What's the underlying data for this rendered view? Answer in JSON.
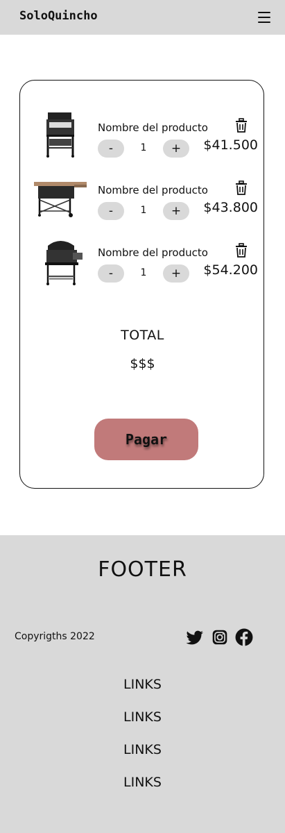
{
  "header": {
    "brand": "SoloQuincho",
    "menu_icon": "hamburger-menu-icon"
  },
  "cart": {
    "items": [
      {
        "name": "Nombre del producto",
        "quantity": "1",
        "price": "$41.500",
        "minus_label": "-",
        "plus_label": "+",
        "image": "grill-product-image",
        "delete_icon": "trash-icon"
      },
      {
        "name": "Nombre del producto",
        "quantity": "1",
        "price": "$43.800",
        "minus_label": "-",
        "plus_label": "+",
        "image": "grill-product-image",
        "delete_icon": "trash-icon"
      },
      {
        "name": "Nombre del producto",
        "quantity": "1",
        "price": "$54.200",
        "minus_label": "-",
        "plus_label": "+",
        "image": "grill-product-image",
        "delete_icon": "trash-icon"
      }
    ],
    "total_label": "TOTAL",
    "total_value": "$$$",
    "pay_label": "Pagar"
  },
  "footer": {
    "title": "FOOTER",
    "copyright": "Copyrigths 2022",
    "social": [
      "twitter-icon",
      "instagram-icon",
      "facebook-icon"
    ],
    "links": [
      "LINKS",
      "LINKS",
      "LINKS",
      "LINKS"
    ]
  },
  "colors": {
    "header_bg": "#d9d9d9",
    "footer_bg": "#d9d9d9",
    "pay_button": "#c17a7a",
    "qty_button": "#d9d9d9"
  }
}
